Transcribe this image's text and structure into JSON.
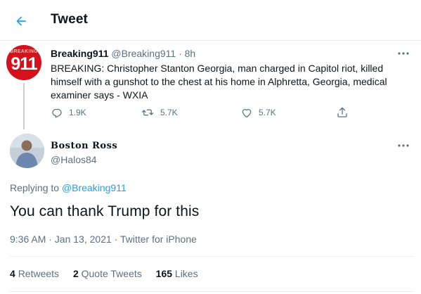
{
  "header": {
    "title": "Tweet"
  },
  "parent_tweet": {
    "avatar_text_small": "BREAKING",
    "avatar_text_big": "911",
    "author_name": "Breaking911",
    "handle": "@Breaking911",
    "separator": "·",
    "time": "8h",
    "text": "BREAKING: Christopher Stanton Georgia, man charged in Capitol riot, killed himself with a gunshot to the chest at his home in Alphretta, Georgia, medical examiner says - WXIA",
    "replies": "1.9K",
    "retweets": "5.7K",
    "likes": "5.7K"
  },
  "reply_tweet": {
    "author_name": "Boston Ross",
    "handle": "@Halos84",
    "replying_prefix": "Replying to",
    "replying_to": "@Breaking911",
    "text": "You can thank Trump for this",
    "timestamp": "9:36 AM · Jan 13, 2021 · Twitter for iPhone",
    "retweets_count": "4",
    "retweets_label": "Retweets",
    "quote_count": "2",
    "quote_label": "Quote Tweets",
    "likes_count": "165",
    "likes_label": "Likes"
  },
  "colors": {
    "accent": "#1da1f2",
    "muted": "#5b7083",
    "text": "#0f1419",
    "avatar_red": "#d3121b"
  }
}
